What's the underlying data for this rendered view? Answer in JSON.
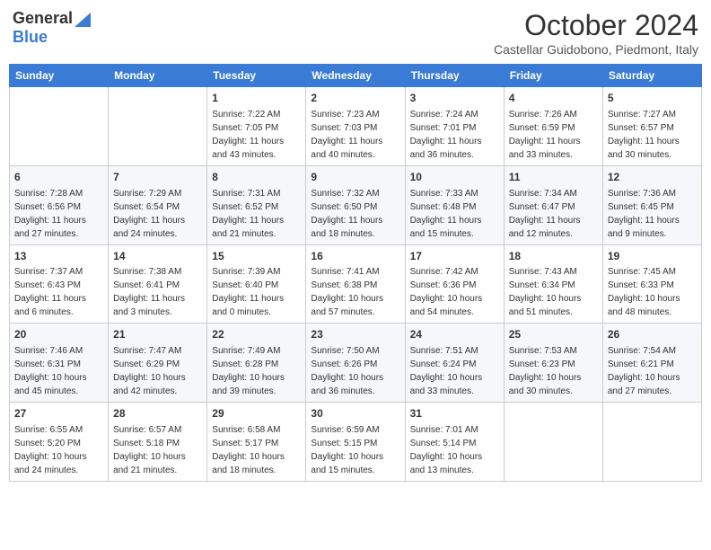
{
  "header": {
    "logo_general": "General",
    "logo_blue": "Blue",
    "month": "October 2024",
    "location": "Castellar Guidobono, Piedmont, Italy"
  },
  "days_of_week": [
    "Sunday",
    "Monday",
    "Tuesday",
    "Wednesday",
    "Thursday",
    "Friday",
    "Saturday"
  ],
  "weeks": [
    [
      {
        "day": "",
        "sunrise": "",
        "sunset": "",
        "daylight": ""
      },
      {
        "day": "",
        "sunrise": "",
        "sunset": "",
        "daylight": ""
      },
      {
        "day": "1",
        "sunrise": "Sunrise: 7:22 AM",
        "sunset": "Sunset: 7:05 PM",
        "daylight": "Daylight: 11 hours and 43 minutes."
      },
      {
        "day": "2",
        "sunrise": "Sunrise: 7:23 AM",
        "sunset": "Sunset: 7:03 PM",
        "daylight": "Daylight: 11 hours and 40 minutes."
      },
      {
        "day": "3",
        "sunrise": "Sunrise: 7:24 AM",
        "sunset": "Sunset: 7:01 PM",
        "daylight": "Daylight: 11 hours and 36 minutes."
      },
      {
        "day": "4",
        "sunrise": "Sunrise: 7:26 AM",
        "sunset": "Sunset: 6:59 PM",
        "daylight": "Daylight: 11 hours and 33 minutes."
      },
      {
        "day": "5",
        "sunrise": "Sunrise: 7:27 AM",
        "sunset": "Sunset: 6:57 PM",
        "daylight": "Daylight: 11 hours and 30 minutes."
      }
    ],
    [
      {
        "day": "6",
        "sunrise": "Sunrise: 7:28 AM",
        "sunset": "Sunset: 6:56 PM",
        "daylight": "Daylight: 11 hours and 27 minutes."
      },
      {
        "day": "7",
        "sunrise": "Sunrise: 7:29 AM",
        "sunset": "Sunset: 6:54 PM",
        "daylight": "Daylight: 11 hours and 24 minutes."
      },
      {
        "day": "8",
        "sunrise": "Sunrise: 7:31 AM",
        "sunset": "Sunset: 6:52 PM",
        "daylight": "Daylight: 11 hours and 21 minutes."
      },
      {
        "day": "9",
        "sunrise": "Sunrise: 7:32 AM",
        "sunset": "Sunset: 6:50 PM",
        "daylight": "Daylight: 11 hours and 18 minutes."
      },
      {
        "day": "10",
        "sunrise": "Sunrise: 7:33 AM",
        "sunset": "Sunset: 6:48 PM",
        "daylight": "Daylight: 11 hours and 15 minutes."
      },
      {
        "day": "11",
        "sunrise": "Sunrise: 7:34 AM",
        "sunset": "Sunset: 6:47 PM",
        "daylight": "Daylight: 11 hours and 12 minutes."
      },
      {
        "day": "12",
        "sunrise": "Sunrise: 7:36 AM",
        "sunset": "Sunset: 6:45 PM",
        "daylight": "Daylight: 11 hours and 9 minutes."
      }
    ],
    [
      {
        "day": "13",
        "sunrise": "Sunrise: 7:37 AM",
        "sunset": "Sunset: 6:43 PM",
        "daylight": "Daylight: 11 hours and 6 minutes."
      },
      {
        "day": "14",
        "sunrise": "Sunrise: 7:38 AM",
        "sunset": "Sunset: 6:41 PM",
        "daylight": "Daylight: 11 hours and 3 minutes."
      },
      {
        "day": "15",
        "sunrise": "Sunrise: 7:39 AM",
        "sunset": "Sunset: 6:40 PM",
        "daylight": "Daylight: 11 hours and 0 minutes."
      },
      {
        "day": "16",
        "sunrise": "Sunrise: 7:41 AM",
        "sunset": "Sunset: 6:38 PM",
        "daylight": "Daylight: 10 hours and 57 minutes."
      },
      {
        "day": "17",
        "sunrise": "Sunrise: 7:42 AM",
        "sunset": "Sunset: 6:36 PM",
        "daylight": "Daylight: 10 hours and 54 minutes."
      },
      {
        "day": "18",
        "sunrise": "Sunrise: 7:43 AM",
        "sunset": "Sunset: 6:34 PM",
        "daylight": "Daylight: 10 hours and 51 minutes."
      },
      {
        "day": "19",
        "sunrise": "Sunrise: 7:45 AM",
        "sunset": "Sunset: 6:33 PM",
        "daylight": "Daylight: 10 hours and 48 minutes."
      }
    ],
    [
      {
        "day": "20",
        "sunrise": "Sunrise: 7:46 AM",
        "sunset": "Sunset: 6:31 PM",
        "daylight": "Daylight: 10 hours and 45 minutes."
      },
      {
        "day": "21",
        "sunrise": "Sunrise: 7:47 AM",
        "sunset": "Sunset: 6:29 PM",
        "daylight": "Daylight: 10 hours and 42 minutes."
      },
      {
        "day": "22",
        "sunrise": "Sunrise: 7:49 AM",
        "sunset": "Sunset: 6:28 PM",
        "daylight": "Daylight: 10 hours and 39 minutes."
      },
      {
        "day": "23",
        "sunrise": "Sunrise: 7:50 AM",
        "sunset": "Sunset: 6:26 PM",
        "daylight": "Daylight: 10 hours and 36 minutes."
      },
      {
        "day": "24",
        "sunrise": "Sunrise: 7:51 AM",
        "sunset": "Sunset: 6:24 PM",
        "daylight": "Daylight: 10 hours and 33 minutes."
      },
      {
        "day": "25",
        "sunrise": "Sunrise: 7:53 AM",
        "sunset": "Sunset: 6:23 PM",
        "daylight": "Daylight: 10 hours and 30 minutes."
      },
      {
        "day": "26",
        "sunrise": "Sunrise: 7:54 AM",
        "sunset": "Sunset: 6:21 PM",
        "daylight": "Daylight: 10 hours and 27 minutes."
      }
    ],
    [
      {
        "day": "27",
        "sunrise": "Sunrise: 6:55 AM",
        "sunset": "Sunset: 5:20 PM",
        "daylight": "Daylight: 10 hours and 24 minutes."
      },
      {
        "day": "28",
        "sunrise": "Sunrise: 6:57 AM",
        "sunset": "Sunset: 5:18 PM",
        "daylight": "Daylight: 10 hours and 21 minutes."
      },
      {
        "day": "29",
        "sunrise": "Sunrise: 6:58 AM",
        "sunset": "Sunset: 5:17 PM",
        "daylight": "Daylight: 10 hours and 18 minutes."
      },
      {
        "day": "30",
        "sunrise": "Sunrise: 6:59 AM",
        "sunset": "Sunset: 5:15 PM",
        "daylight": "Daylight: 10 hours and 15 minutes."
      },
      {
        "day": "31",
        "sunrise": "Sunrise: 7:01 AM",
        "sunset": "Sunset: 5:14 PM",
        "daylight": "Daylight: 10 hours and 13 minutes."
      },
      {
        "day": "",
        "sunrise": "",
        "sunset": "",
        "daylight": ""
      },
      {
        "day": "",
        "sunrise": "",
        "sunset": "",
        "daylight": ""
      }
    ]
  ]
}
